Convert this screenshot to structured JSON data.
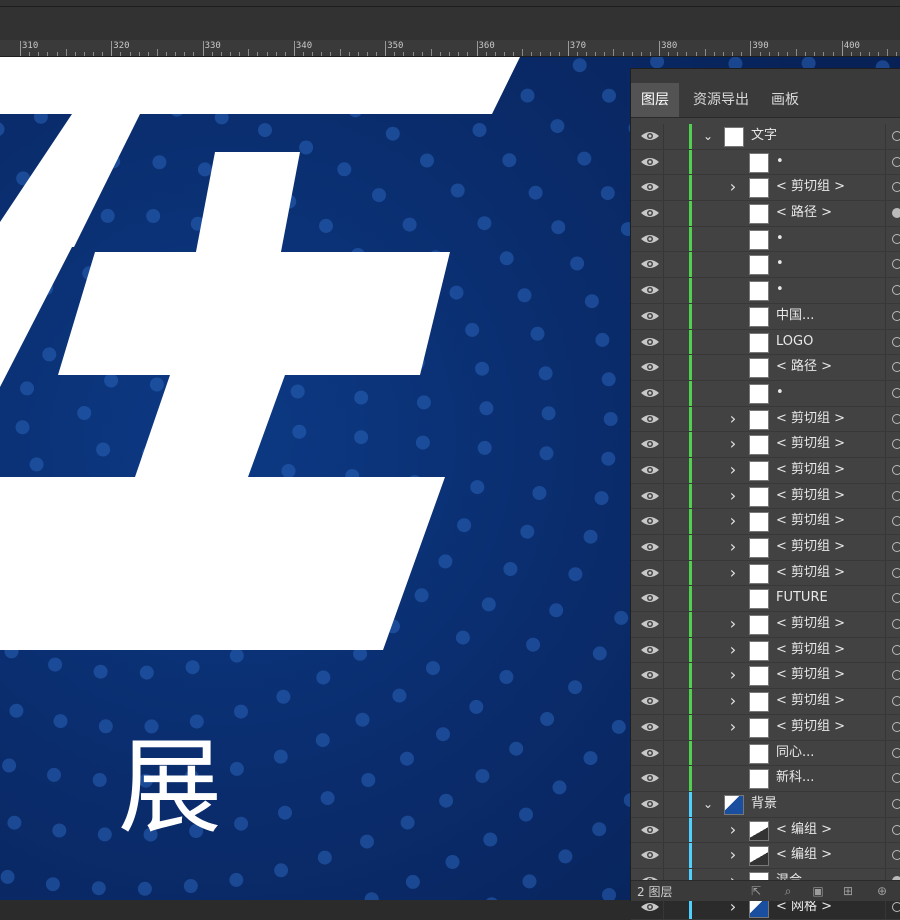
{
  "ruler": {
    "labels": [
      "310",
      "320",
      "330",
      "340",
      "350",
      "360",
      "370",
      "380",
      "390",
      "400"
    ]
  },
  "canvas": {
    "background_colors": [
      "#0c3a85",
      "#071f52"
    ],
    "dot_color": "#2a63b8",
    "visible_char": "展"
  },
  "panel": {
    "tabs": [
      {
        "label": "图层",
        "active": true
      },
      {
        "label": "资源导出",
        "active": false
      },
      {
        "label": "画板",
        "active": false
      }
    ],
    "layers": [
      {
        "name": "文字",
        "level": 0,
        "expand": "open",
        "bar": "#4fd14f",
        "circle": "outline"
      },
      {
        "name": "•",
        "level": 1,
        "expand": "none",
        "bar": "#4fd14f",
        "circle": "outline"
      },
      {
        "name": "< 剪切组 >",
        "level": 1,
        "expand": "closed",
        "bar": "#4fd14f",
        "circle": "outline"
      },
      {
        "name": "< 路径 >",
        "level": 1,
        "expand": "none",
        "bar": "#4fd14f",
        "circle": "filled"
      },
      {
        "name": "•",
        "level": 1,
        "expand": "none",
        "bar": "#4fd14f",
        "circle": "outline"
      },
      {
        "name": "•",
        "level": 1,
        "expand": "none",
        "bar": "#4fd14f",
        "circle": "outline"
      },
      {
        "name": "•",
        "level": 1,
        "expand": "none",
        "bar": "#4fd14f",
        "circle": "outline"
      },
      {
        "name": "中国...",
        "level": 1,
        "expand": "none",
        "bar": "#4fd14f",
        "circle": "outline"
      },
      {
        "name": "LOGO",
        "level": 1,
        "expand": "none",
        "bar": "#4fd14f",
        "circle": "outline"
      },
      {
        "name": "< 路径 >",
        "level": 1,
        "expand": "none",
        "bar": "#4fd14f",
        "circle": "outline"
      },
      {
        "name": "•",
        "level": 1,
        "expand": "none",
        "bar": "#4fd14f",
        "circle": "outline"
      },
      {
        "name": "< 剪切组 >",
        "level": 1,
        "expand": "closed",
        "bar": "#4fd14f",
        "circle": "outline"
      },
      {
        "name": "< 剪切组 >",
        "level": 1,
        "expand": "closed",
        "bar": "#4fd14f",
        "circle": "outline"
      },
      {
        "name": "< 剪切组 >",
        "level": 1,
        "expand": "closed",
        "bar": "#4fd14f",
        "circle": "outline"
      },
      {
        "name": "< 剪切组 >",
        "level": 1,
        "expand": "closed",
        "bar": "#4fd14f",
        "circle": "outline"
      },
      {
        "name": "< 剪切组 >",
        "level": 1,
        "expand": "closed",
        "bar": "#4fd14f",
        "circle": "outline"
      },
      {
        "name": "< 剪切组 >",
        "level": 1,
        "expand": "closed",
        "bar": "#4fd14f",
        "circle": "outline"
      },
      {
        "name": "< 剪切组 >",
        "level": 1,
        "expand": "closed",
        "bar": "#4fd14f",
        "circle": "outline"
      },
      {
        "name": "FUTURE",
        "level": 1,
        "expand": "none",
        "bar": "#4fd14f",
        "circle": "outline"
      },
      {
        "name": "< 剪切组 >",
        "level": 1,
        "expand": "closed",
        "bar": "#4fd14f",
        "circle": "outline"
      },
      {
        "name": "< 剪切组 >",
        "level": 1,
        "expand": "closed",
        "bar": "#4fd14f",
        "circle": "outline"
      },
      {
        "name": "< 剪切组 >",
        "level": 1,
        "expand": "closed",
        "bar": "#4fd14f",
        "circle": "outline"
      },
      {
        "name": "< 剪切组 >",
        "level": 1,
        "expand": "closed",
        "bar": "#4fd14f",
        "circle": "outline"
      },
      {
        "name": "< 剪切组 >",
        "level": 1,
        "expand": "closed",
        "bar": "#4fd14f",
        "circle": "outline"
      },
      {
        "name": "同心...",
        "level": 1,
        "expand": "none",
        "bar": "#4fd14f",
        "circle": "outline"
      },
      {
        "name": "新科...",
        "level": 1,
        "expand": "none",
        "bar": "#4fd14f",
        "circle": "outline"
      },
      {
        "name": "背景",
        "level": 0,
        "expand": "open",
        "bar": "#4fd0ff",
        "circle": "outline",
        "thumb": "blue"
      },
      {
        "name": "< 编组 >",
        "level": 1,
        "expand": "closed",
        "bar": "#4fd0ff",
        "circle": "outline",
        "thumb": "dark"
      },
      {
        "name": "< 编组 >",
        "level": 1,
        "expand": "closed",
        "bar": "#4fd0ff",
        "circle": "outline",
        "thumb": "dark"
      },
      {
        "name": "混合",
        "level": 1,
        "expand": "closed",
        "bar": "#4fd0ff",
        "circle": "filled",
        "thumb": "light"
      },
      {
        "name": "< 网格 >",
        "level": 1,
        "expand": "closed",
        "bar": "#4fd0ff",
        "circle": "outline",
        "thumb": "blue"
      }
    ],
    "footer": {
      "layer_count": "2 图层"
    }
  }
}
